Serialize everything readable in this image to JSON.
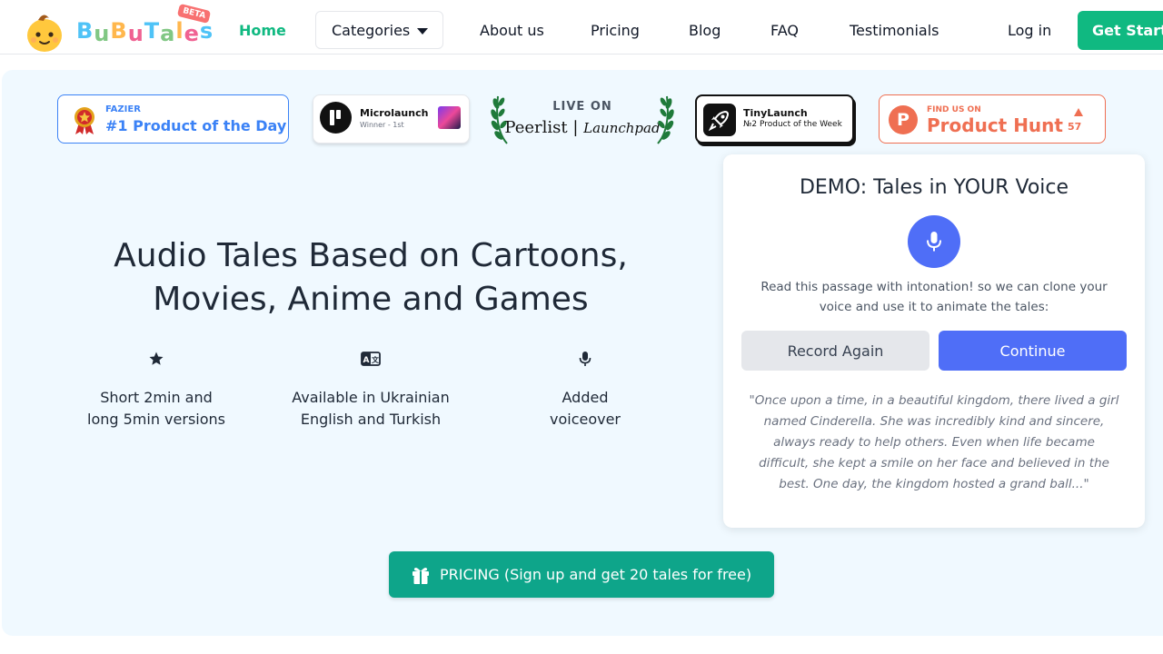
{
  "brand": {
    "letters": [
      "B",
      "u",
      "B",
      "u",
      "T",
      "a",
      "l",
      "e",
      "s"
    ],
    "letter_colors": [
      "#4fc3f7",
      "#81c784",
      "#ffb74d",
      "#f06292",
      "#4fc3f7",
      "#81c784",
      "#ffb74d",
      "#f06292",
      "#4fc3f7"
    ],
    "beta": "BETA",
    "mascot_icon": "baby-face-icon"
  },
  "nav": {
    "home": "Home",
    "categories": "Categories",
    "about": "About us",
    "pricing": "Pricing",
    "blog": "Blog",
    "faq": "FAQ",
    "testimonials": "Testimonials",
    "login": "Log in",
    "get_started": "Get Started"
  },
  "badges": {
    "fazier": {
      "small": "FAZIER",
      "big": "#1 Product of the Day"
    },
    "microlaunch": {
      "title": "Microlaunch",
      "sub": "Winner - 1st"
    },
    "peerlist": {
      "line1": "LIVE ON",
      "brand": "Peerlist",
      "sub": "Launchpad"
    },
    "tinylaunch": {
      "title": "TinyLaunch",
      "sub": "№2 Product of the Week"
    },
    "producthunt": {
      "small": "FIND US ON",
      "big": "Product Hunt",
      "count": "57",
      "letter": "P"
    }
  },
  "hero": {
    "headline_line1": "Audio Tales Based on Cartoons,",
    "headline_line2": "Movies, Anime and Games",
    "features": [
      {
        "icon": "star-icon",
        "line1": "Short 2min and",
        "line2": "long 5min versions"
      },
      {
        "icon": "translate-icon",
        "line1": "Available in Ukrainian",
        "line2": "English and Turkish"
      },
      {
        "icon": "microphone-icon",
        "line1": "Added",
        "line2": "voiceover"
      }
    ],
    "pricing_button": "PRICING (Sign up and get 20 tales for free)"
  },
  "demo": {
    "title": "DEMO: Tales in YOUR Voice",
    "description": "Read this passage with intonation! so we can clone your voice and use it to animate the tales:",
    "record_again": "Record Again",
    "continue": "Continue",
    "passage": "\"Once upon a time, in a beautiful kingdom, there lived a girl named Cinderella. She was incredibly kind and sincere, always ready to help others. Even when life became difficult, she kept a smile on her face and believed in the best. One day, the kingdom hosted a grand ball...\""
  },
  "colors": {
    "accent_green": "#10b981",
    "accent_blue": "#4f6ef7",
    "hero_bg": "#f0f9ff",
    "producthunt": "#ef6f52",
    "fazier": "#3b82f6"
  }
}
